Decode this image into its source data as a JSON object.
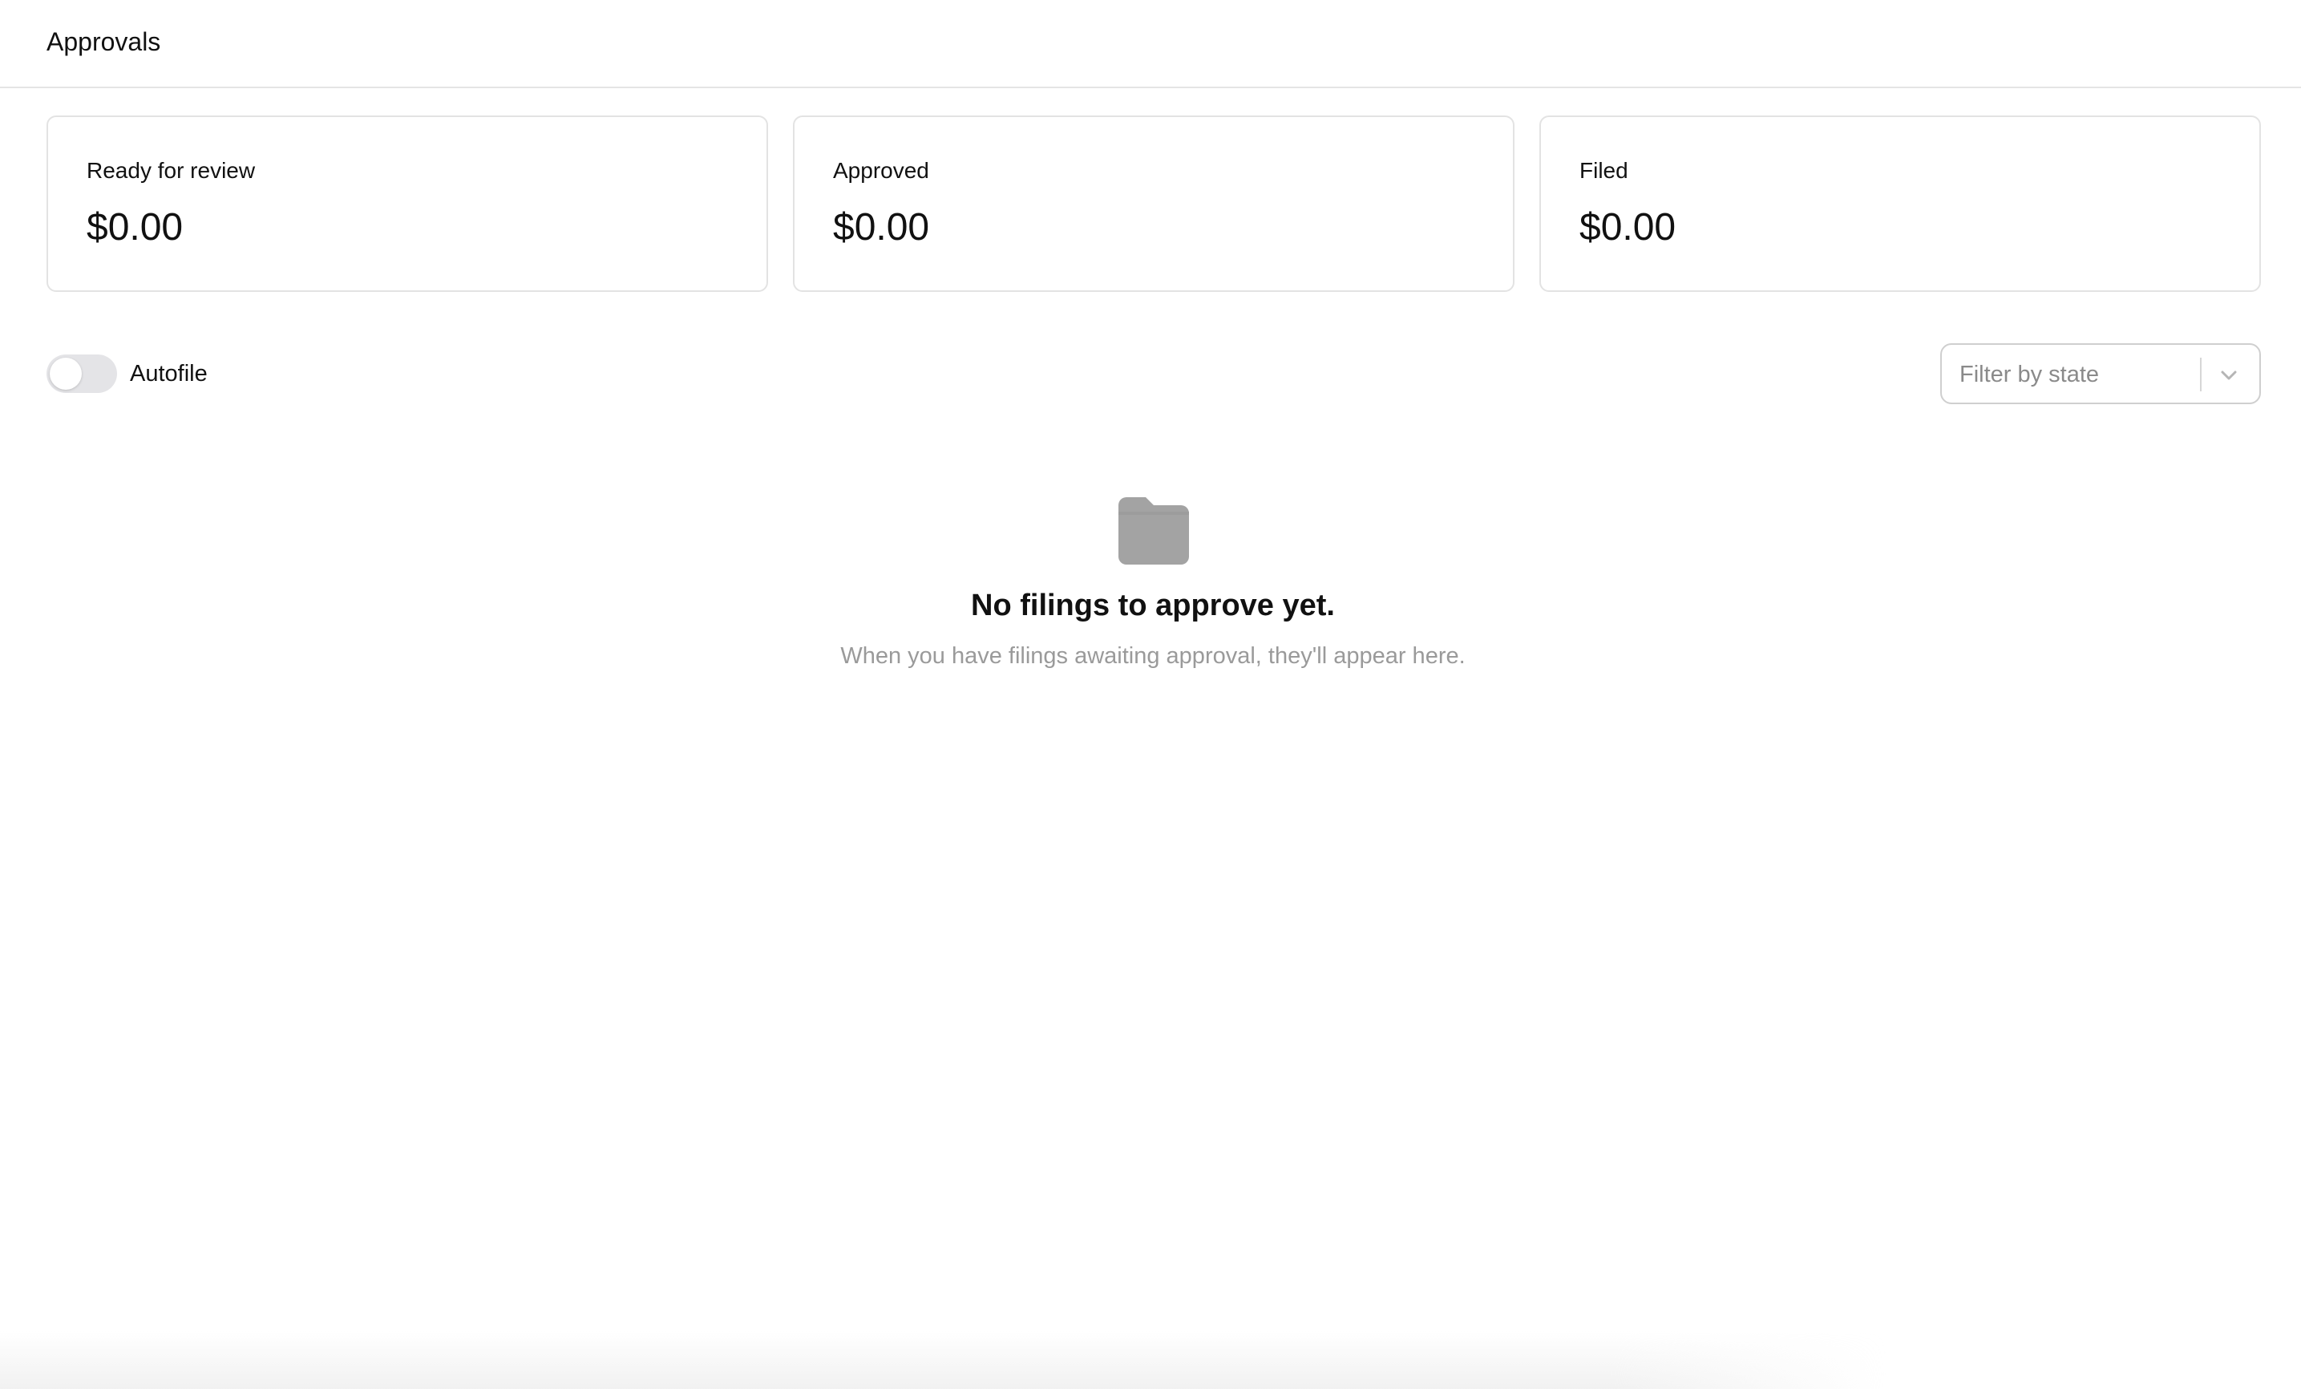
{
  "header": {
    "title": "Approvals"
  },
  "summary_cards": [
    {
      "label": "Ready for review",
      "value": "$0.00"
    },
    {
      "label": "Approved",
      "value": "$0.00"
    },
    {
      "label": "Filed",
      "value": "$0.00"
    }
  ],
  "controls": {
    "autofile_label": "Autofile",
    "autofile_enabled": false,
    "filter_placeholder": "Filter by state",
    "filter_icon": "chevron-down-icon"
  },
  "empty_state": {
    "icon": "folder-icon",
    "title": "No filings to approve yet.",
    "subtitle": "When you have filings awaiting approval, they'll appear here."
  },
  "colors": {
    "toggle_off": "#e4e4e7",
    "folder_icon": "#a3a3a3",
    "muted_text": "#9a9a9a",
    "border": "#e3e3e3"
  }
}
